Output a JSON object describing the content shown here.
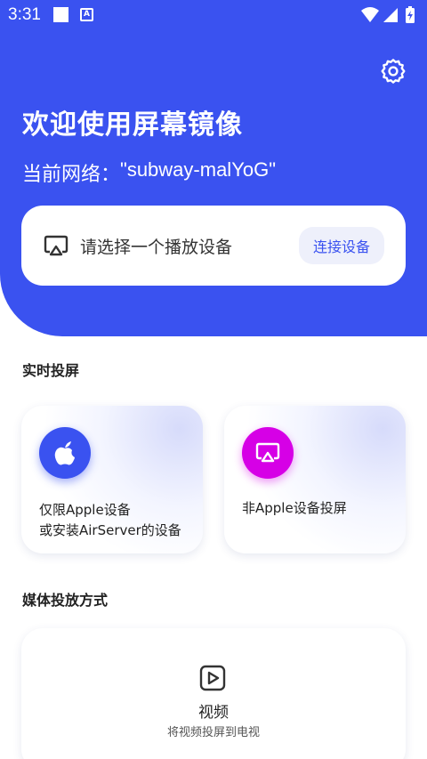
{
  "status_bar": {
    "time": "3:31",
    "notification_letter": "A"
  },
  "header": {
    "title": "欢迎使用屏幕镜像",
    "network_label": "当前网络：",
    "network_name": "\"subway-malYoG\""
  },
  "device_card": {
    "prompt": "请选择一个播放设备",
    "connect_label": "连接设备"
  },
  "realtime_section": {
    "title": "实时投屏",
    "apple_card": {
      "line1": "仅限Apple设备",
      "line2": "或安装AirServer的设备"
    },
    "other_card": {
      "label": "非Apple设备投屏"
    }
  },
  "media_section": {
    "title": "媒体投放方式",
    "video_card": {
      "title": "视频",
      "desc": "将视频投屏到电视"
    }
  },
  "colors": {
    "primary": "#3a52f0",
    "accent_magenta": "#d600e6",
    "background": "#ffffff"
  }
}
